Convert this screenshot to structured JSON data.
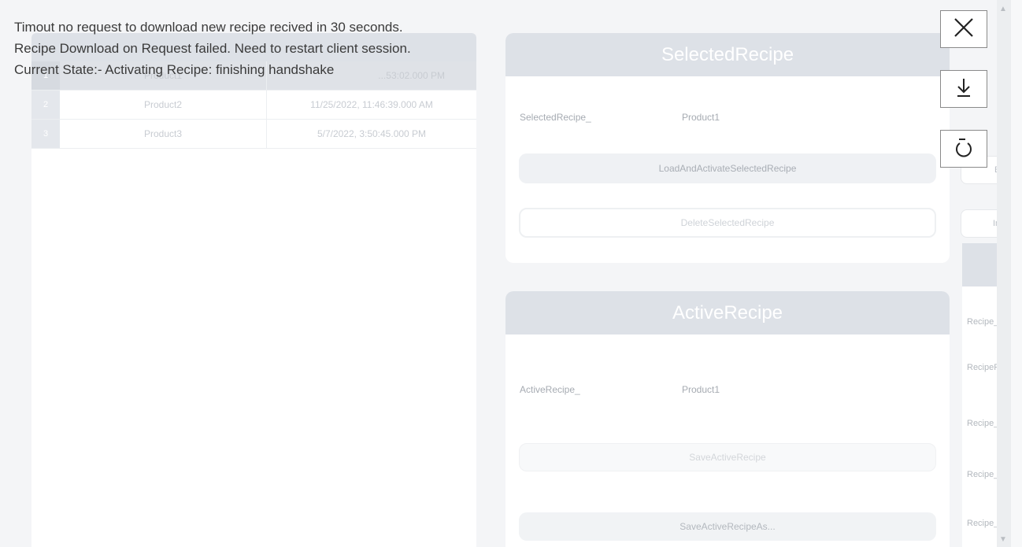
{
  "overlay_message": {
    "line1": "Timout no request to download new recipe recived in 30 seconds.",
    "line2": "Recipe Download on Request failed. Need to restart client session.",
    "line3": "Current State:- Activating Recipe: finishing handshake"
  },
  "recipe_table": {
    "rows": [
      {
        "index": "1",
        "name": "Product1",
        "date": "...53:02.000 PM"
      },
      {
        "index": "2",
        "name": "Product2",
        "date": "11/25/2022, 11:46:39.000 AM"
      },
      {
        "index": "3",
        "name": "Product3",
        "date": "5/7/2022, 3:50:45.000 PM"
      }
    ]
  },
  "selected_recipe": {
    "title": "SelectedRecipe",
    "field_label": "SelectedRecipe_",
    "field_value": "Product1",
    "load_button": "LoadAndActivateSelectedRecipe",
    "delete_button": "DeleteSelectedRecipe"
  },
  "active_recipe": {
    "title": "ActiveRecipe",
    "field_label": "ActiveRecipe_",
    "field_value": "Product1",
    "save_button": "SaveActiveRecipe",
    "save_as_button": "SaveActiveRecipeAs..."
  },
  "right_panel": {
    "export_button": "Expo",
    "import_button": "Impo",
    "labels": [
      "Recipe_H",
      "RecipePL",
      "Recipe_D",
      "Recipe_C",
      "Recipe_Li"
    ]
  },
  "toolbar": {
    "close_icon": "close-icon",
    "download_icon": "download-icon",
    "refresh_icon": "refresh-icon"
  },
  "colors": {
    "header_bg": "#dde1e7",
    "card_bg": "#ffffff",
    "page_bg": "#f4f5f7"
  }
}
